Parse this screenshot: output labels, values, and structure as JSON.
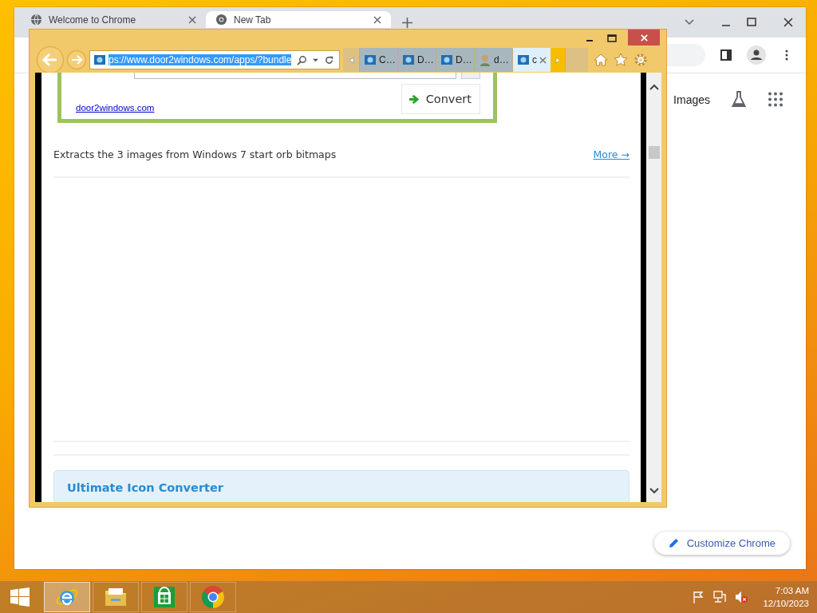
{
  "chrome_window": {
    "tabs": [
      {
        "title": "Welcome to Chrome",
        "selected": false
      },
      {
        "title": "New Tab",
        "selected": true
      }
    ],
    "shortcut_label": "Images",
    "customize_button": "Customize Chrome"
  },
  "ie_window": {
    "address": "ps://www.door2windows.com/apps/?bundle",
    "address_selected": true,
    "tabs": [
      {
        "title": "C…",
        "kind": "site",
        "selected": false
      },
      {
        "title": "D…",
        "kind": "site",
        "selected": false
      },
      {
        "title": "D…",
        "kind": "site",
        "selected": false
      },
      {
        "title": "d…",
        "kind": "avatar",
        "selected": false
      },
      {
        "title": "c",
        "kind": "site",
        "selected": true
      }
    ],
    "page": {
      "site_link": "door2windows.com",
      "convert_button": "Convert",
      "description": "Extracts the 3 images from Windows 7 start orb bitmaps",
      "more_link": "More →",
      "card_title": "Ultimate Icon Converter"
    }
  },
  "taskbar": {
    "apps": [
      {
        "kind": "ie",
        "selected": true
      },
      {
        "kind": "explorer",
        "selected": false
      },
      {
        "kind": "store",
        "selected": false
      },
      {
        "kind": "chrome",
        "selected": false
      }
    ],
    "time": "7:03 AM",
    "date": "12/10/2023"
  }
}
